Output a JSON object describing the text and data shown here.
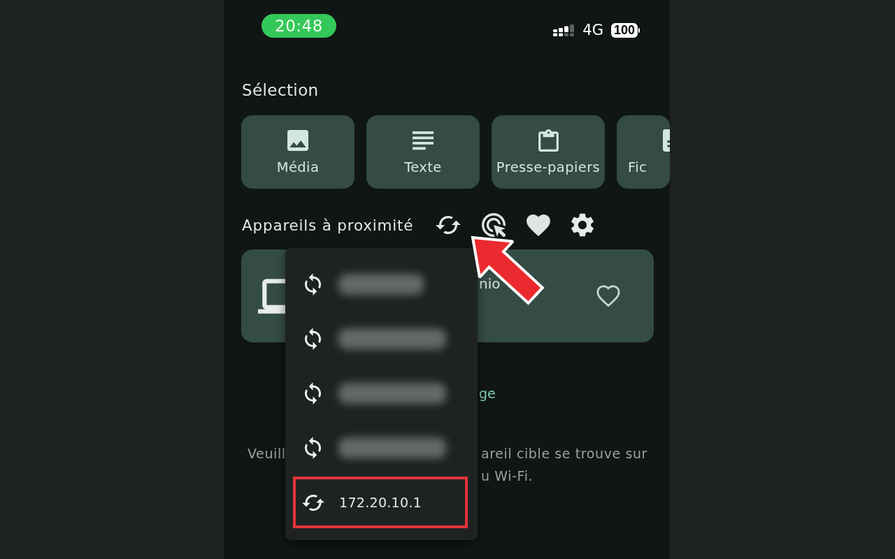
{
  "status_bar": {
    "time": "20:48",
    "network": "4G",
    "battery": "100"
  },
  "selection": {
    "title": "Sélection",
    "cards": [
      {
        "kind": "media",
        "label": "Média"
      },
      {
        "kind": "text",
        "label": "Texte"
      },
      {
        "kind": "clipboard",
        "label": "Presse-papiers"
      },
      {
        "kind": "file",
        "label": "Fic"
      }
    ]
  },
  "nearby": {
    "title": "Appareils à proximité",
    "device": {
      "name": "nio",
      "favorite": false
    },
    "link": "ge",
    "hint": {
      "left": "Veuill",
      "right_lines": [
        "areil cible se trouve sur",
        "u Wi-Fi."
      ]
    }
  },
  "menu": {
    "items": [
      {
        "kind": "blurred",
        "highlighted": false
      },
      {
        "kind": "blurred",
        "highlighted": false
      },
      {
        "kind": "blurred",
        "highlighted": false
      },
      {
        "kind": "blurred",
        "highlighted": false
      },
      {
        "kind": "address",
        "label": "172.20.10.1",
        "highlighted": true
      }
    ]
  },
  "annotation": {
    "arrow": true
  }
}
